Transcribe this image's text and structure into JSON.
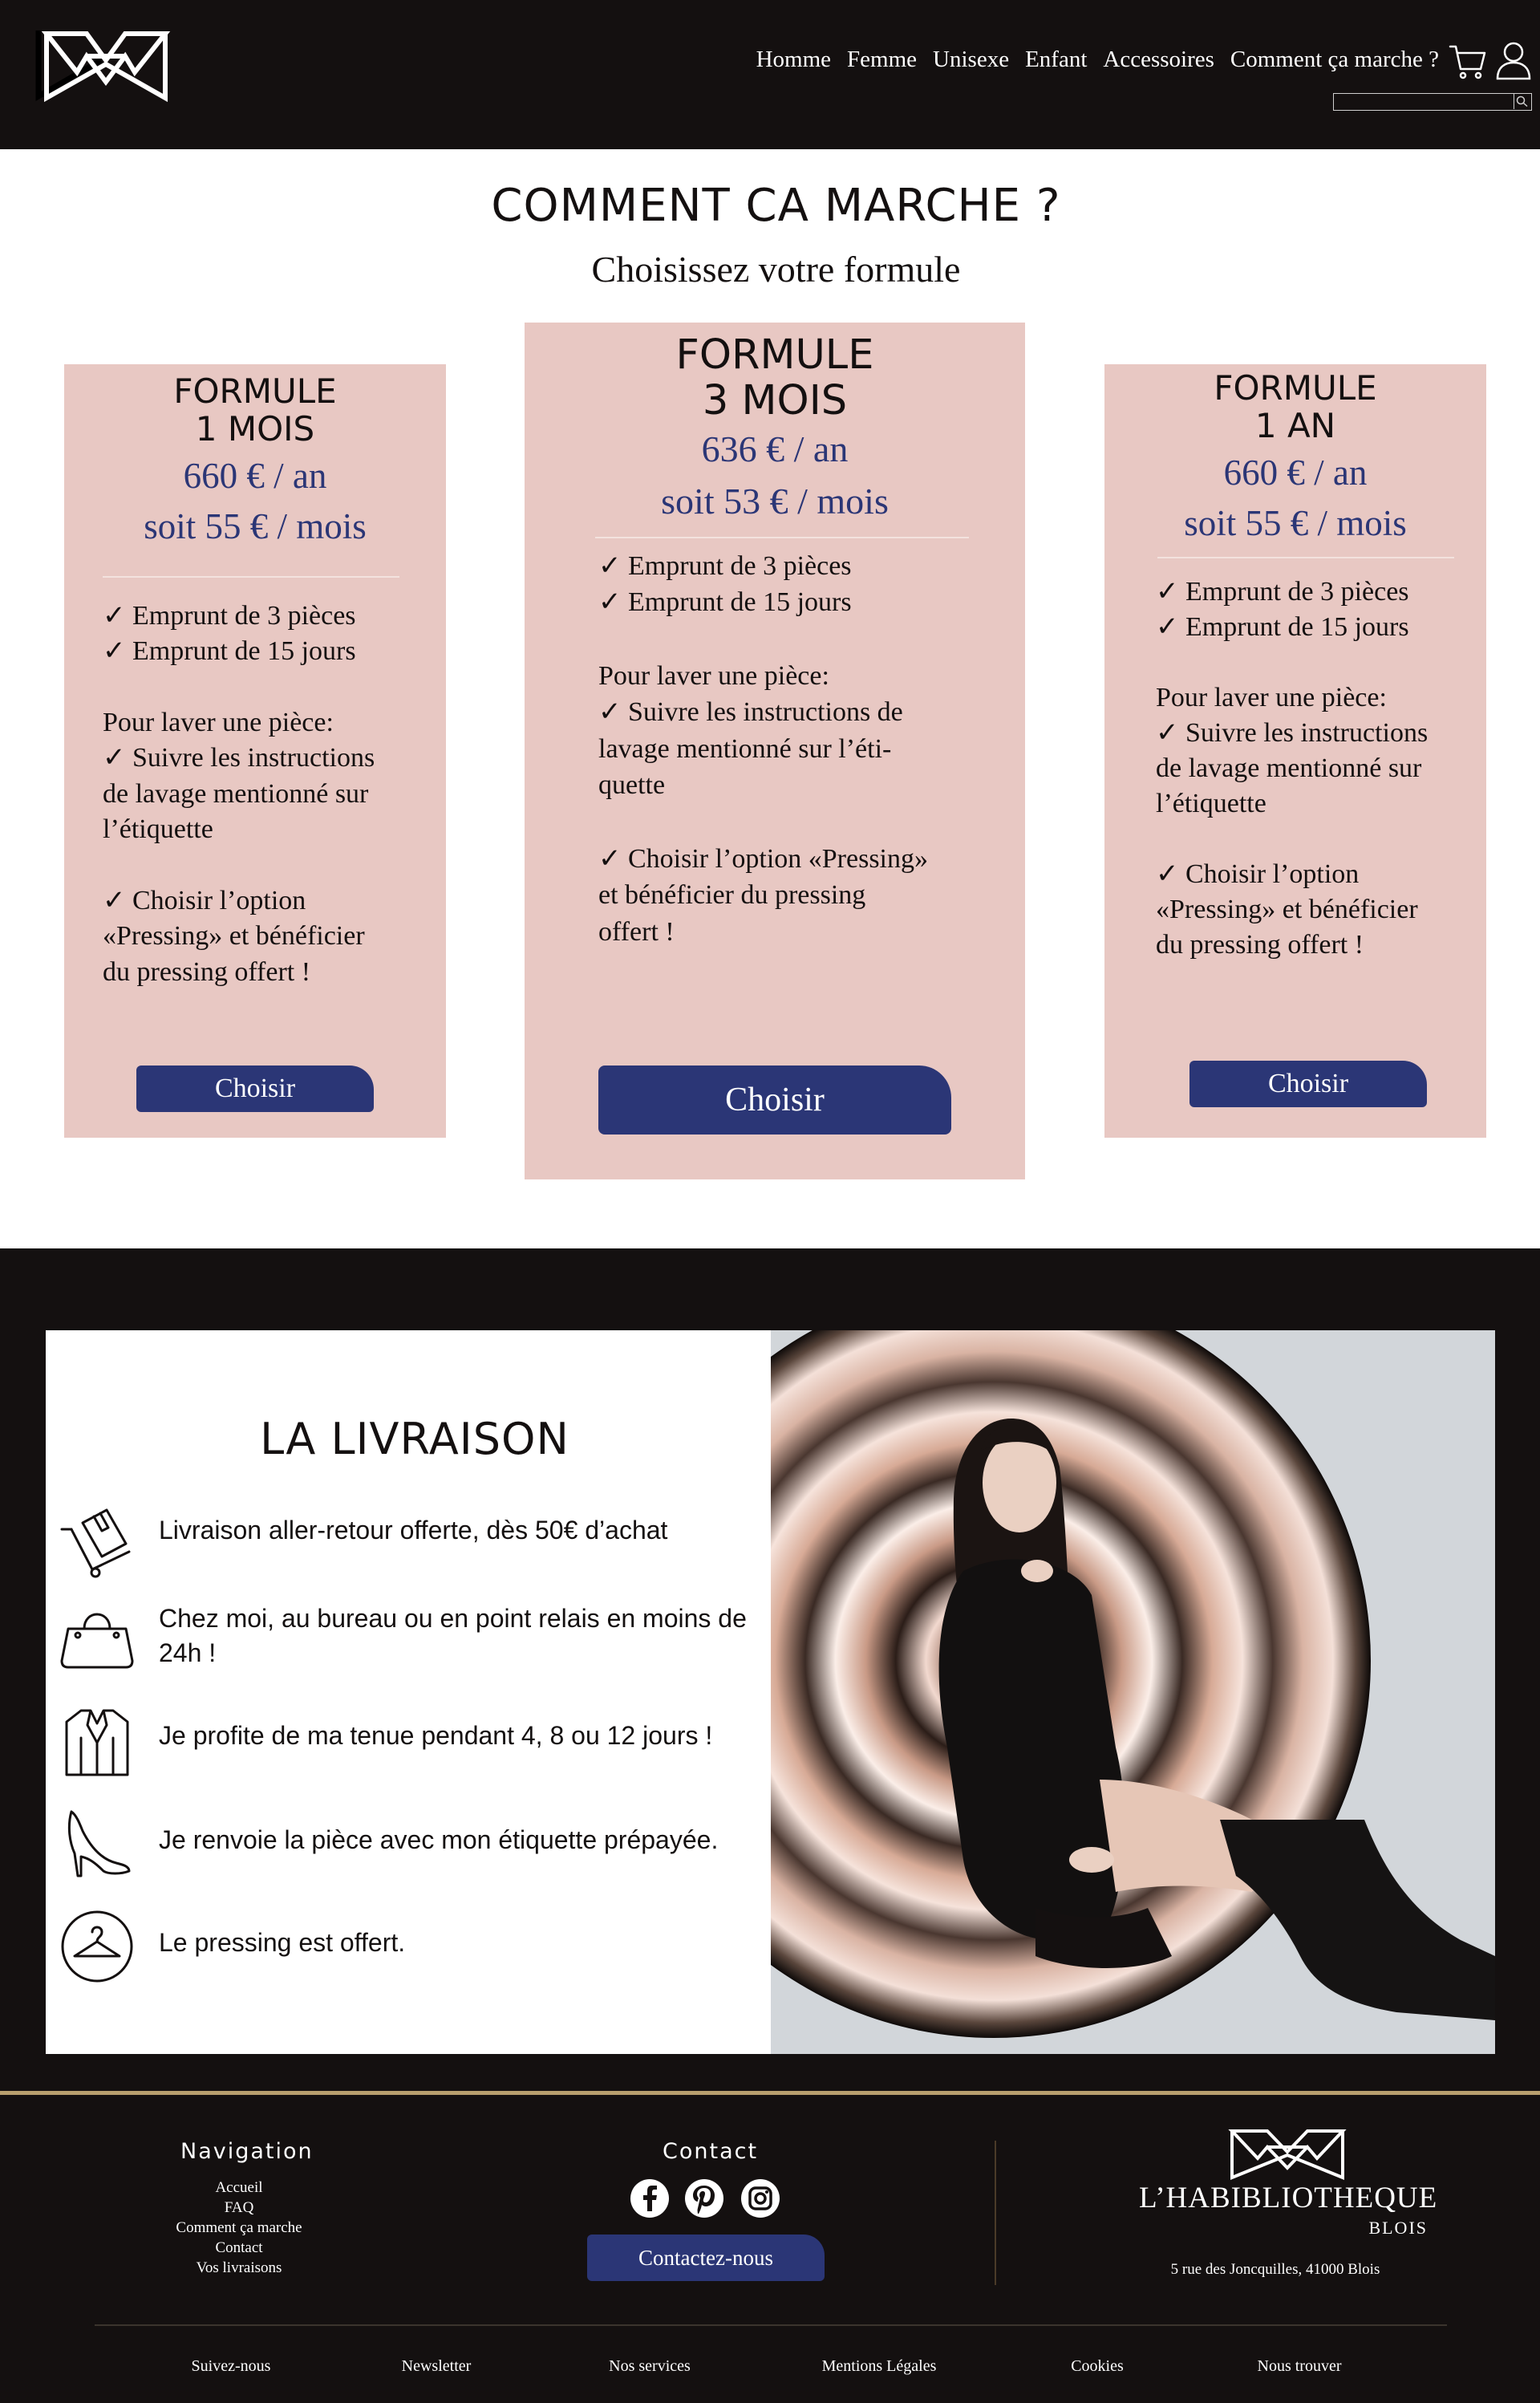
{
  "header": {
    "nav": [
      "Homme",
      "Femme",
      "Unisexe",
      "Enfant",
      "Accessoires",
      "Comment ça marche ?"
    ],
    "search_placeholder": ""
  },
  "pricing": {
    "title": "COMMENT CA MARCHE ?",
    "subtitle": "Choisissez votre formule",
    "plans": [
      {
        "title_line1": "FORMULE",
        "title_line2": "1 MOIS",
        "price_line1": "660 € / an",
        "price_line2": "soit 55 € / mois",
        "body": [
          "✓ Emprunt de 3 pièces",
          "✓ Emprunt de 15 jours",
          "",
          "Pour laver une pièce:",
          "✓ Suivre les instructions",
          "de lavage mentionné sur",
          "l’étiquette",
          "",
          "✓ Choisir l’option",
          "«Pressing» et bénéficier",
          "du pressing offert !"
        ],
        "button": "Choisir"
      },
      {
        "title_line1": "FORMULE",
        "title_line2": "3 MOIS",
        "price_line1": "636 € / an",
        "price_line2": "soit 53 € / mois",
        "body": [
          "✓ Emprunt de 3 pièces",
          "✓ Emprunt de 15 jours",
          "",
          "Pour laver une pièce:",
          "✓ Suivre les instructions de",
          "lavage mentionné sur l’éti-",
          "quette",
          "",
          "✓ Choisir l’option «Pressing»",
          "et bénéficier du pressing",
          "offert !"
        ],
        "button": "Choisir"
      },
      {
        "title_line1": "FORMULE",
        "title_line2": "1 AN",
        "price_line1": "660 € / an",
        "price_line2": "soit 55 € / mois",
        "body": [
          "✓ Emprunt de 3 pièces",
          "✓ Emprunt de 15 jours",
          "",
          "Pour laver une pièce:",
          "✓ Suivre les instructions",
          "de lavage mentionné sur",
          "l’étiquette",
          "",
          "✓ Choisir l’option",
          "«Pressing» et bénéficier",
          "du pressing offert !"
        ],
        "button": "Choisir"
      }
    ]
  },
  "delivery": {
    "title": "LA LIVRAISON",
    "items": [
      {
        "icon": "box-trolley-icon",
        "text": "Livraison aller-retour offerte, dès 50€ d’achat"
      },
      {
        "icon": "handbag-icon",
        "text": "Chez moi, au bureau ou en point relais en moins de 24h !"
      },
      {
        "icon": "jacket-icon",
        "text": "Je profite de ma tenue pendant 4, 8 ou 12 jours !"
      },
      {
        "icon": "high-heel-icon",
        "text": "Je renvoie la pièce avec mon étiquette prépayée."
      },
      {
        "icon": "hanger-icon",
        "text": "Le pressing est offert."
      }
    ]
  },
  "footer": {
    "nav_title": "Navigation",
    "nav_links": [
      "Accueil",
      "FAQ",
      "Comment ça marche",
      "Contact",
      "Vos livraisons"
    ],
    "contact_title": "Contact",
    "social_icons": [
      "facebook-icon",
      "pinterest-icon",
      "instagram-icon"
    ],
    "contact_button": "Contactez-nous",
    "brand_name": "L’HABIBLIOTHEQUE",
    "brand_city": "BLOIS",
    "address": "5 rue des Joncquilles, 41000 Blois",
    "bottom_links": [
      "Suivez-nous",
      "Newsletter",
      "Nos services",
      "Mentions Légales",
      "Cookies",
      "Nous trouver"
    ]
  },
  "colors": {
    "dark": "#141010",
    "pink": "#e8c8c3",
    "navy": "#2b3676",
    "gold": "#b89f6e"
  }
}
